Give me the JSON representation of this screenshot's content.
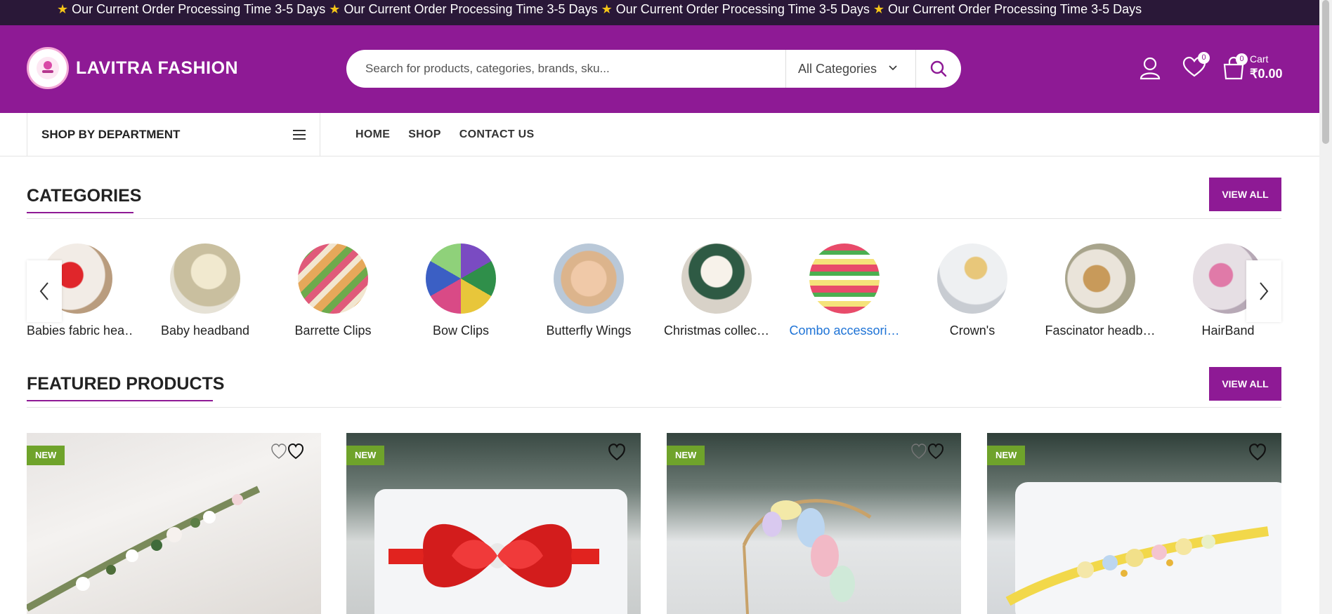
{
  "announcement": {
    "items": [
      "Our Current Order Processing Time 3-5 Days",
      "Our Current Order Processing Time 3-5 Days",
      "Our Current Order Processing Time 3-5 Days",
      "Our Current Order Processing Time 3-5 Days"
    ],
    "icon": "star-icon"
  },
  "header": {
    "brand": "LAVITRA FASHION",
    "search_placeholder": "Search for products, categories, brands, sku...",
    "category_select": "All Categories",
    "wishlist_count": "0",
    "cart_count": "0",
    "cart_label": "Cart",
    "cart_total": "₹0.00"
  },
  "nav": {
    "department": "SHOP BY DEPARTMENT",
    "links": [
      "HOME",
      "SHOP",
      "CONTACT US"
    ]
  },
  "categories": {
    "title": "CATEGORIES",
    "view_all": "VIEW ALL",
    "items": [
      "Babies fabric hea…",
      "Baby headband",
      "Barrette Clips",
      "Bow Clips",
      "Butterfly Wings",
      "Christmas collec…",
      "Combo accessori…",
      "Crown's",
      "Fascinator headb…",
      "HairBand"
    ]
  },
  "featured": {
    "title": "FEATURED PRODUCTS",
    "view_all": "VIEW ALL",
    "badge_new": "NEW"
  },
  "colors": {
    "brand_purple": "#8e1a95",
    "topbar": "#2a1838",
    "new_badge": "#6fa32b",
    "link_blue": "#1e73d6"
  }
}
